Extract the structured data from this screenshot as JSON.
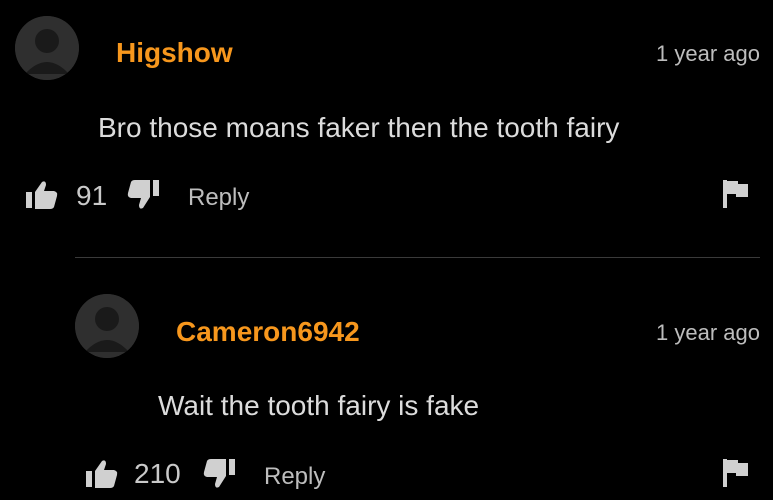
{
  "colors": {
    "background": "#000000",
    "username": "#f7971d",
    "text": "#dcdcdc",
    "muted": "#bdbdbd",
    "icon": "#d0d0d0",
    "avatar": "#2f2f2f",
    "divider": "#3a3a3a"
  },
  "comments": [
    {
      "username": "Higshow",
      "timestamp": "1 year ago",
      "text": "Bro those moans faker then the tooth fairy",
      "likes": "91",
      "reply_label": "Reply",
      "icons": {
        "avatar": "user-avatar-icon",
        "like": "thumbs-up-icon",
        "dislike": "thumbs-down-icon",
        "flag": "flag-icon"
      }
    },
    {
      "username": "Cameron6942",
      "timestamp": "1 year ago",
      "text": "Wait the tooth fairy is fake",
      "likes": "210",
      "reply_label": "Reply",
      "icons": {
        "avatar": "user-avatar-icon",
        "like": "thumbs-up-icon",
        "dislike": "thumbs-down-icon",
        "flag": "flag-icon"
      }
    }
  ]
}
